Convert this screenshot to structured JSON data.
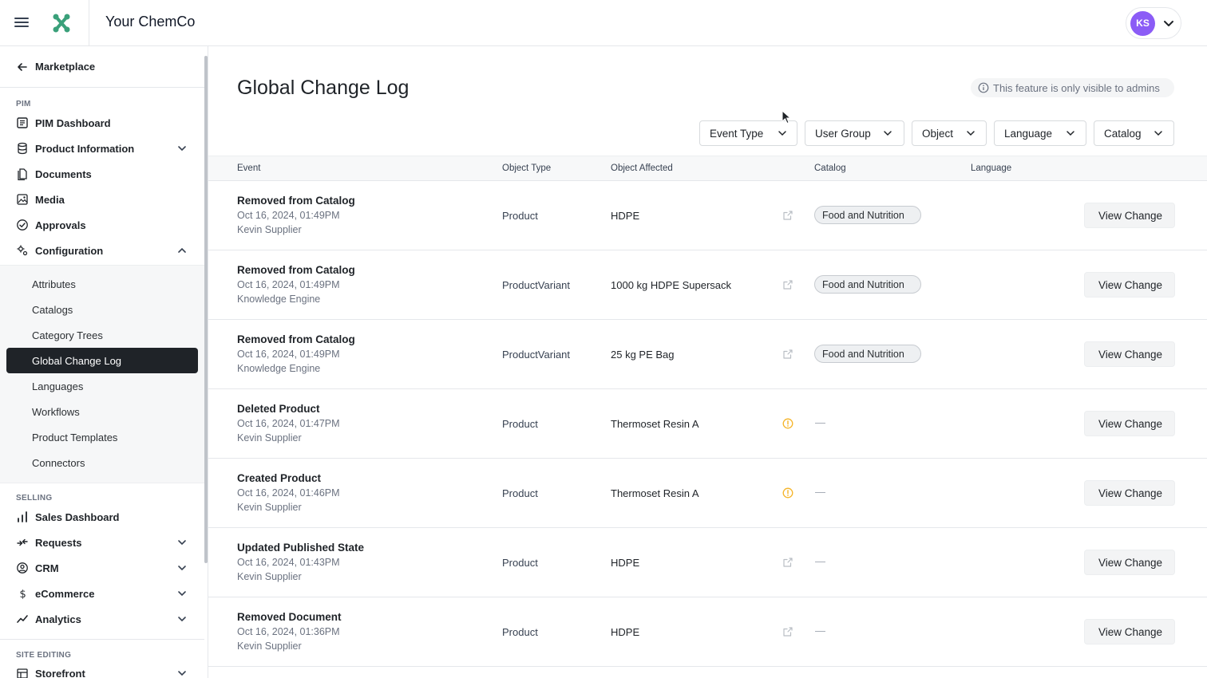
{
  "header": {
    "company_name": "Your ChemCo",
    "user_initials": "KS",
    "avatar_color": "#8b5cf6"
  },
  "sidebar": {
    "back_label": "Marketplace",
    "sections": {
      "pim": "PIM",
      "selling": "SELLING",
      "site_editing": "SITE EDITING"
    },
    "pim_items": [
      {
        "label": "PIM Dashboard",
        "icon": "dashboard-icon"
      },
      {
        "label": "Product Information",
        "icon": "database-icon"
      },
      {
        "label": "Documents",
        "icon": "documents-icon"
      },
      {
        "label": "Media",
        "icon": "media-icon"
      },
      {
        "label": "Approvals",
        "icon": "approvals-icon"
      },
      {
        "label": "Configuration",
        "icon": "configuration-icon"
      }
    ],
    "config_subitems": [
      "Attributes",
      "Catalogs",
      "Category Trees",
      "Global Change Log",
      "Languages",
      "Workflows",
      "Product Templates",
      "Connectors"
    ],
    "active_subitem": "Global Change Log",
    "selling_items": [
      {
        "label": "Sales Dashboard",
        "icon": "bar-chart-icon"
      },
      {
        "label": "Requests",
        "icon": "requests-icon"
      },
      {
        "label": "CRM",
        "icon": "crm-icon"
      },
      {
        "label": "eCommerce",
        "icon": "dollar-icon"
      },
      {
        "label": "Analytics",
        "icon": "analytics-icon"
      }
    ],
    "site_items": [
      {
        "label": "Storefront",
        "icon": "storefront-icon"
      }
    ]
  },
  "main": {
    "title": "Global Change Log",
    "admin_note": "This feature is only visible to admins",
    "filters": [
      "Event Type",
      "User Group",
      "Object",
      "Language",
      "Catalog"
    ],
    "columns": {
      "event": "Event",
      "object_type": "Object Type",
      "object_affected": "Object Affected",
      "catalog": "Catalog",
      "language": "Language"
    },
    "view_change_label": "View Change",
    "rows": [
      {
        "event": "Removed from Catalog",
        "date": "Oct 16, 2024, 01:49PM",
        "user": "Kevin Supplier",
        "object_type": "Product",
        "object_affected": "HDPE",
        "status_icon": "external-link-icon",
        "catalog": "Food and Nutrition"
      },
      {
        "event": "Removed from Catalog",
        "date": "Oct 16, 2024, 01:49PM",
        "user": "Knowledge Engine",
        "object_type": "ProductVariant",
        "object_affected": "1000 kg HDPE Supersack",
        "status_icon": "external-link-icon",
        "catalog": "Food and Nutrition"
      },
      {
        "event": "Removed from Catalog",
        "date": "Oct 16, 2024, 01:49PM",
        "user": "Knowledge Engine",
        "object_type": "ProductVariant",
        "object_affected": "25 kg PE Bag",
        "status_icon": "external-link-icon",
        "catalog": "Food and Nutrition"
      },
      {
        "event": "Deleted Product",
        "date": "Oct 16, 2024, 01:47PM",
        "user": "Kevin Supplier",
        "object_type": "Product",
        "object_affected": "Thermoset Resin A",
        "status_icon": "info-warning-icon",
        "catalog": "—"
      },
      {
        "event": "Created Product",
        "date": "Oct 16, 2024, 01:46PM",
        "user": "Kevin Supplier",
        "object_type": "Product",
        "object_affected": "Thermoset Resin A",
        "status_icon": "info-warning-icon",
        "catalog": "—"
      },
      {
        "event": "Updated Published State",
        "date": "Oct 16, 2024, 01:43PM",
        "user": "Kevin Supplier",
        "object_type": "Product",
        "object_affected": "HDPE",
        "status_icon": "external-link-icon",
        "catalog": "—"
      },
      {
        "event": "Removed Document",
        "date": "Oct 16, 2024, 01:36PM",
        "user": "Kevin Supplier",
        "object_type": "Product",
        "object_affected": "HDPE",
        "status_icon": "external-link-icon",
        "catalog": "—"
      }
    ]
  },
  "colors": {
    "brand": "#3aa07a",
    "active_nav": "#1f2328",
    "warning": "#f5b428"
  }
}
